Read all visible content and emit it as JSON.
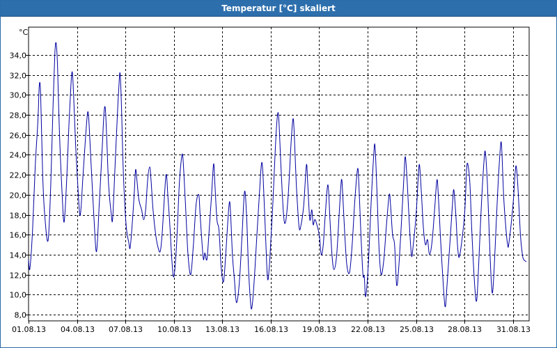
{
  "window": {
    "title": "Temperatur [°C] skaliert"
  },
  "colors": {
    "titlebar": "#2d6fad",
    "series": "#0000a0",
    "grid": "#000000",
    "background": "#ffffff"
  },
  "chart_data": {
    "type": "line",
    "title": "Temperatur [°C] skaliert",
    "ylabel": "°C",
    "xlabel": "",
    "ylim": [
      8,
      36
    ],
    "yticks": [
      8,
      10,
      12,
      14,
      16,
      18,
      20,
      22,
      24,
      26,
      28,
      30,
      32,
      34
    ],
    "ytick_labels": [
      "8,0",
      "10,0",
      "12,0",
      "14,0",
      "16,0",
      "18,0",
      "20,0",
      "22,0",
      "24,0",
      "26,0",
      "28,0",
      "30,0",
      "32,0",
      "34,0"
    ],
    "xlim": [
      "01.08.13",
      "01.09.13"
    ],
    "xtick_labels": [
      "01.08.13",
      "04.08.13",
      "07.08.13",
      "10.08.13",
      "13.08.13",
      "16.08.13",
      "19.08.13",
      "22.08.13",
      "25.08.13",
      "28.08.13",
      "31.08.13"
    ],
    "grid": true,
    "series_points": [
      [
        "01.08.13 00:00",
        13.5
      ],
      [
        "01.08.13 02:00",
        12.6
      ],
      [
        "01.08.13 06:00",
        16.5
      ],
      [
        "01.08.13 10:00",
        23.0
      ],
      [
        "01.08.13 14:00",
        27.5
      ],
      [
        "01.08.13 16:00",
        31.0
      ],
      [
        "01.08.13 18:00",
        30.0
      ],
      [
        "01.08.13 21:00",
        22.0
      ],
      [
        "02.08.13 00:00",
        18.0
      ],
      [
        "02.08.13 05:00",
        15.4
      ],
      [
        "02.08.13 09:00",
        21.0
      ],
      [
        "02.08.13 12:00",
        28.0
      ],
      [
        "02.08.13 15:00",
        34.0
      ],
      [
        "02.08.13 17:00",
        35.2
      ],
      [
        "02.08.13 19:00",
        33.0
      ],
      [
        "02.08.13 22:00",
        26.0
      ],
      [
        "03.08.13 02:00",
        20.0
      ],
      [
        "03.08.13 05:00",
        17.3
      ],
      [
        "03.08.13 09:00",
        22.0
      ],
      [
        "03.08.13 12:00",
        27.0
      ],
      [
        "03.08.13 15:00",
        31.0
      ],
      [
        "03.08.13 17:00",
        32.3
      ],
      [
        "03.08.13 19:00",
        30.0
      ],
      [
        "03.08.13 22:00",
        25.0
      ],
      [
        "04.08.13 02:00",
        20.0
      ],
      [
        "04.08.13 05:00",
        18.0
      ],
      [
        "04.08.13 09:00",
        22.0
      ],
      [
        "04.08.13 13:00",
        26.0
      ],
      [
        "04.08.13 16:00",
        28.3
      ],
      [
        "04.08.13 18:00",
        27.0
      ],
      [
        "04.08.13 21:00",
        23.0
      ],
      [
        "05.08.13 01:00",
        18.0
      ],
      [
        "05.08.13 05:00",
        14.3
      ],
      [
        "05.08.13 09:00",
        19.0
      ],
      [
        "05.08.13 13:00",
        24.0
      ],
      [
        "05.08.13 16:00",
        28.0
      ],
      [
        "05.08.13 18:00",
        28.7
      ],
      [
        "05.08.13 20:00",
        26.0
      ],
      [
        "05.08.13 23:00",
        21.0
      ],
      [
        "06.08.13 03:00",
        18.0
      ],
      [
        "06.08.13 05:00",
        17.6
      ],
      [
        "06.08.13 08:00",
        22.0
      ],
      [
        "06.08.13 12:00",
        28.0
      ],
      [
        "06.08.13 14:00",
        30.5
      ],
      [
        "06.08.13 16:00",
        32.2
      ],
      [
        "06.08.13 18:00",
        29.0
      ],
      [
        "06.08.13 21:00",
        22.0
      ],
      [
        "07.08.13 01:00",
        17.0
      ],
      [
        "07.08.13 05:00",
        15.2
      ],
      [
        "07.08.13 07:00",
        14.7
      ],
      [
        "07.08.13 10:00",
        17.0
      ],
      [
        "07.08.13 13:00",
        20.0
      ],
      [
        "07.08.13 15:00",
        22.5
      ],
      [
        "07.08.13 17:00",
        21.5
      ],
      [
        "07.08.13 20:00",
        19.5
      ],
      [
        "08.08.13 00:00",
        18.5
      ],
      [
        "08.08.13 03:00",
        17.5
      ],
      [
        "08.08.13 06:00",
        18.5
      ],
      [
        "08.08.13 09:00",
        21.5
      ],
      [
        "08.08.13 12:00",
        22.8
      ],
      [
        "08.08.13 14:00",
        21.5
      ],
      [
        "08.08.13 17:00",
        18.5
      ],
      [
        "08.08.13 21:00",
        16.0
      ],
      [
        "09.08.13 01:00",
        14.6
      ],
      [
        "09.08.13 04:00",
        14.4
      ],
      [
        "09.08.13 07:00",
        16.5
      ],
      [
        "09.08.13 11:00",
        21.0
      ],
      [
        "09.08.13 13:00",
        22.0
      ],
      [
        "09.08.13 15:00",
        20.0
      ],
      [
        "09.08.13 18:00",
        17.0
      ],
      [
        "09.08.13 21:00",
        13.5
      ],
      [
        "10.08.13 00:00",
        11.8
      ],
      [
        "10.08.13 04:00",
        15.0
      ],
      [
        "10.08.13 08:00",
        21.0
      ],
      [
        "10.08.13 11:00",
        23.5
      ],
      [
        "10.08.13 13:00",
        24.0
      ],
      [
        "10.08.13 15:00",
        22.0
      ],
      [
        "10.08.13 18:00",
        18.0
      ],
      [
        "10.08.13 21:00",
        14.0
      ],
      [
        "11.08.13 01:00",
        12.0
      ],
      [
        "11.08.13 05:00",
        15.0
      ],
      [
        "11.08.13 09:00",
        19.0
      ],
      [
        "11.08.13 13:00",
        20.0
      ],
      [
        "11.08.13 15:00",
        18.0
      ],
      [
        "11.08.13 18:00",
        15.0
      ],
      [
        "11.08.13 20:00",
        13.5
      ],
      [
        "11.08.13 22:00",
        14.2
      ],
      [
        "12.08.13 01:00",
        13.5
      ],
      [
        "12.08.13 04:00",
        16.0
      ],
      [
        "12.08.13 08:00",
        20.0
      ],
      [
        "12.08.13 11:00",
        23.1
      ],
      [
        "12.08.13 13:00",
        21.0
      ],
      [
        "12.08.13 16:00",
        17.5
      ],
      [
        "12.08.13 19:00",
        16.5
      ],
      [
        "12.08.13 22:00",
        13.0
      ],
      [
        "13.08.13 01:00",
        11.3
      ],
      [
        "13.08.13 03:00",
        12.0
      ],
      [
        "13.08.13 06:00",
        15.0
      ],
      [
        "13.08.13 10:00",
        19.0
      ],
      [
        "13.08.13 12:00",
        18.5
      ],
      [
        "13.08.13 15:00",
        14.0
      ],
      [
        "13.08.13 18:00",
        11.5
      ],
      [
        "13.08.13 21:00",
        9.2
      ],
      [
        "14.08.13 01:00",
        11.0
      ],
      [
        "14.08.13 05:00",
        15.5
      ],
      [
        "14.08.13 09:00",
        20.3
      ],
      [
        "14.08.13 12:00",
        18.0
      ],
      [
        "14.08.13 15:00",
        12.5
      ],
      [
        "14.08.13 18:00",
        9.2
      ],
      [
        "14.08.13 20:00",
        8.7
      ],
      [
        "14.08.13 23:00",
        11.0
      ],
      [
        "15.08.13 03:00",
        15.5
      ],
      [
        "15.08.13 07:00",
        20.0
      ],
      [
        "15.08.13 10:00",
        23.0
      ],
      [
        "15.08.13 12:00",
        22.5
      ],
      [
        "15.08.13 15:00",
        18.0
      ],
      [
        "15.08.13 18:00",
        13.0
      ],
      [
        "15.08.13 20:00",
        11.5
      ],
      [
        "15.08.13 23:00",
        14.0
      ],
      [
        "16.08.13 03:00",
        19.0
      ],
      [
        "16.08.13 07:00",
        25.0
      ],
      [
        "16.08.13 10:00",
        28.0
      ],
      [
        "16.08.13 12:00",
        27.5
      ],
      [
        "16.08.13 15:00",
        23.0
      ],
      [
        "16.08.13 19:00",
        18.0
      ],
      [
        "16.08.13 22:00",
        17.3
      ],
      [
        "17.08.13 02:00",
        20.0
      ],
      [
        "17.08.13 06:00",
        25.0
      ],
      [
        "17.08.13 09:00",
        27.6
      ],
      [
        "17.08.13 11:00",
        26.0
      ],
      [
        "17.08.13 14:00",
        21.0
      ],
      [
        "17.08.13 18:00",
        16.8
      ],
      [
        "17.08.13 21:00",
        17.0
      ],
      [
        "18.08.13 01:00",
        19.0
      ],
      [
        "18.08.13 05:00",
        23.0
      ],
      [
        "18.08.13 07:00",
        21.0
      ],
      [
        "18.08.13 10:00",
        17.5
      ],
      [
        "18.08.13 13:00",
        18.5
      ],
      [
        "18.08.13 15:00",
        17.0
      ],
      [
        "18.08.13 18:00",
        17.5
      ],
      [
        "19.08.13 00:00",
        16.0
      ],
      [
        "19.08.13 03:00",
        14.0
      ],
      [
        "19.08.13 06:00",
        15.0
      ],
      [
        "19.08.13 09:00",
        18.0
      ],
      [
        "19.08.13 13:00",
        21.0
      ],
      [
        "19.08.13 16:00",
        17.5
      ],
      [
        "19.08.13 19:00",
        14.0
      ],
      [
        "19.08.13 22:00",
        12.5
      ],
      [
        "20.08.13 02:00",
        14.0
      ],
      [
        "20.08.13 06:00",
        18.5
      ],
      [
        "20.08.13 09:00",
        21.5
      ],
      [
        "20.08.13 11:00",
        20.0
      ],
      [
        "20.08.13 14:00",
        16.0
      ],
      [
        "20.08.13 17:00",
        13.0
      ],
      [
        "20.08.13 21:00",
        12.2
      ],
      [
        "21.08.13 01:00",
        15.0
      ],
      [
        "21.08.13 05:00",
        19.5
      ],
      [
        "21.08.13 09:00",
        22.6
      ],
      [
        "21.08.13 11:00",
        21.0
      ],
      [
        "21.08.13 14:00",
        16.0
      ],
      [
        "21.08.13 17:00",
        12.0
      ],
      [
        "21.08.13 19:00",
        11.8
      ],
      [
        "21.08.13 21:00",
        9.8
      ],
      [
        "22.08.13 01:00",
        13.0
      ],
      [
        "22.08.13 05:00",
        19.0
      ],
      [
        "22.08.13 09:00",
        24.0
      ],
      [
        "22.08.13 11:00",
        24.8
      ],
      [
        "22.08.13 14:00",
        20.0
      ],
      [
        "22.08.13 17:00",
        14.5
      ],
      [
        "22.08.13 20:00",
        12.0
      ],
      [
        "23.08.13 00:00",
        13.5
      ],
      [
        "23.08.13 04:00",
        17.0
      ],
      [
        "23.08.13 08:00",
        20.0
      ],
      [
        "23.08.13 10:00",
        19.0
      ],
      [
        "23.08.13 13:00",
        16.0
      ],
      [
        "23.08.13 16:00",
        15.0
      ],
      [
        "23.08.13 19:00",
        11.0
      ],
      [
        "23.08.13 22:00",
        12.5
      ],
      [
        "24.08.13 02:00",
        17.0
      ],
      [
        "24.08.13 06:00",
        22.0
      ],
      [
        "24.08.13 08:00",
        23.8
      ],
      [
        "24.08.13 11:00",
        21.0
      ],
      [
        "24.08.13 14:00",
        17.0
      ],
      [
        "24.08.13 17:00",
        14.0
      ],
      [
        "24.08.13 19:00",
        14.5
      ],
      [
        "25.08.13 00:00",
        18.0
      ],
      [
        "25.08.13 03:00",
        21.5
      ],
      [
        "25.08.13 05:00",
        23.0
      ],
      [
        "25.08.13 08:00",
        20.0
      ],
      [
        "25.08.13 11:00",
        16.5
      ],
      [
        "25.08.13 14:00",
        15.0
      ],
      [
        "25.08.13 17:00",
        15.5
      ],
      [
        "25.08.13 20:00",
        14.0
      ],
      [
        "26.08.13 00:00",
        15.5
      ],
      [
        "26.08.13 04:00",
        19.0
      ],
      [
        "26.08.13 07:00",
        21.5
      ],
      [
        "26.08.13 09:00",
        20.0
      ],
      [
        "26.08.13 12:00",
        16.0
      ],
      [
        "26.08.13 15:00",
        12.5
      ],
      [
        "26.08.13 19:00",
        8.8
      ],
      [
        "26.08.13 22:00",
        11.0
      ],
      [
        "27.08.13 02:00",
        15.0
      ],
      [
        "27.08.13 06:00",
        19.0
      ],
      [
        "27.08.13 08:00",
        20.5
      ],
      [
        "27.08.13 11:00",
        18.0
      ],
      [
        "27.08.13 14:00",
        14.5
      ],
      [
        "27.08.13 17:00",
        14.0
      ],
      [
        "28.08.13 00:00",
        18.0
      ],
      [
        "28.08.13 03:00",
        22.5
      ],
      [
        "28.08.13 05:00",
        23.0
      ],
      [
        "28.08.13 08:00",
        21.0
      ],
      [
        "28.08.13 11:00",
        16.0
      ],
      [
        "28.08.13 15:00",
        11.0
      ],
      [
        "28.08.13 18:00",
        9.4
      ],
      [
        "28.08.13 21:00",
        13.0
      ],
      [
        "29.08.13 01:00",
        19.0
      ],
      [
        "29.08.13 05:00",
        23.5
      ],
      [
        "29.08.13 07:00",
        24.2
      ],
      [
        "29.08.13 10:00",
        21.0
      ],
      [
        "29.08.13 13:00",
        15.5
      ],
      [
        "29.08.13 16:00",
        11.0
      ],
      [
        "29.08.13 18:00",
        10.4
      ],
      [
        "29.08.13 21:00",
        14.0
      ],
      [
        "30.08.13 01:00",
        20.0
      ],
      [
        "30.08.13 05:00",
        24.5
      ],
      [
        "30.08.13 07:00",
        24.9
      ],
      [
        "30.08.13 10:00",
        20.0
      ],
      [
        "30.08.13 13:00",
        17.0
      ],
      [
        "30.08.13 16:00",
        15.0
      ],
      [
        "30.08.13 18:00",
        15.2
      ],
      [
        "31.08.13 00:00",
        19.0
      ],
      [
        "31.08.13 03:00",
        22.0
      ],
      [
        "31.08.13 05:00",
        22.8
      ],
      [
        "31.08.13 08:00",
        20.0
      ],
      [
        "31.08.13 11:00",
        16.0
      ],
      [
        "31.08.13 14:00",
        14.0
      ],
      [
        "31.08.13 16:00",
        13.5
      ],
      [
        "31.08.13 20:00",
        13.3
      ]
    ]
  }
}
